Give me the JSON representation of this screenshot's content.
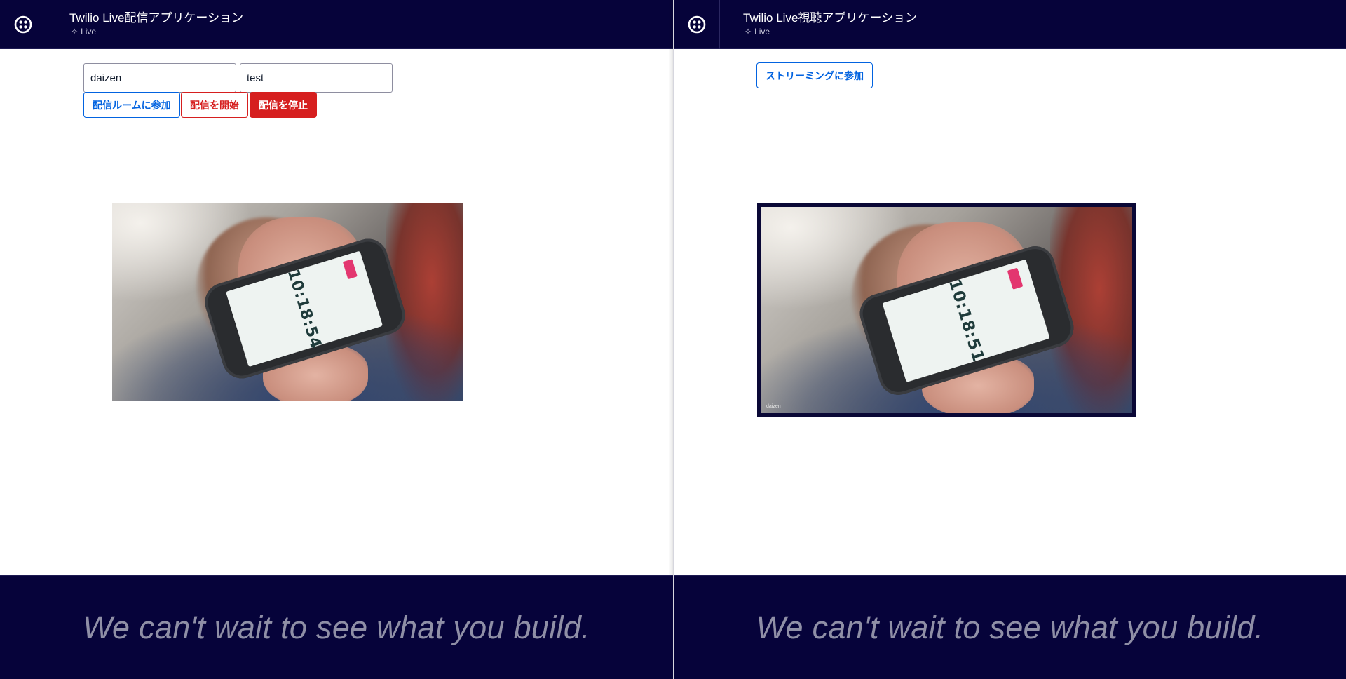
{
  "broadcaster": {
    "header": {
      "title": "Twilio Live配信アプリケーション",
      "subtitle": "Live"
    },
    "form": {
      "identity_value": "daizen",
      "room_value": "test"
    },
    "buttons": {
      "join": "配信ルームに参加",
      "start": "配信を開始",
      "stop": "配信を停止"
    },
    "video": {
      "clock": "10:18:54"
    },
    "footer": {
      "tagline": "We can't wait to see what you build."
    }
  },
  "viewer": {
    "header": {
      "title": "Twilio Live視聴アプリケーション",
      "subtitle": "Live"
    },
    "buttons": {
      "join": "ストリーミングに参加"
    },
    "video": {
      "clock": "10:18:51",
      "name_label": "daizen"
    },
    "footer": {
      "tagline": "We can't wait to see what you build."
    }
  },
  "colors": {
    "header_bg": "#06033a",
    "accent_blue": "#0263e0",
    "destructive_red": "#d61f1f",
    "tagline_gray": "#8f8fa6"
  },
  "icons": {
    "logo": "twilio-logo-icon",
    "live": "sparkle-icon"
  }
}
